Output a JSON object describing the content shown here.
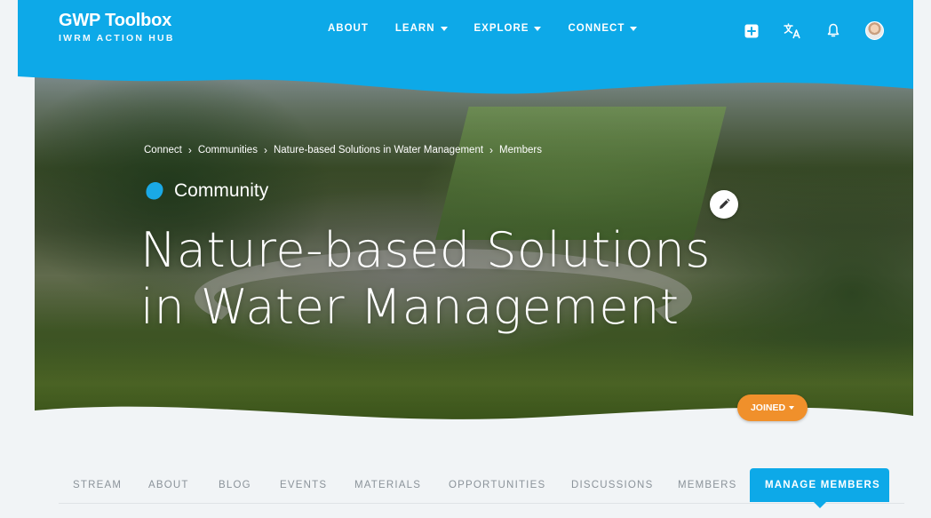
{
  "brand": {
    "title": "GWP Toolbox",
    "subtitle": "IWRM ACTION HUB"
  },
  "nav": [
    {
      "label": "ABOUT",
      "dropdown": false
    },
    {
      "label": "LEARN",
      "dropdown": true
    },
    {
      "label": "EXPLORE",
      "dropdown": true
    },
    {
      "label": "CONNECT",
      "dropdown": true
    }
  ],
  "header_icons": [
    "add-icon",
    "translate-icon",
    "bell-icon",
    "avatar"
  ],
  "breadcrumb": [
    "Connect",
    "Communities",
    "Nature-based Solutions in Water Management",
    "Members"
  ],
  "breadcrumb_separator": "›",
  "community_label": "Community",
  "page_title": "Nature-based Solutions in Water Management",
  "joined_button": "JOINED",
  "tabs": [
    {
      "label": "STREAM",
      "active": false
    },
    {
      "label": "ABOUT",
      "active": false
    },
    {
      "label": "BLOG",
      "active": false
    },
    {
      "label": "EVENTS",
      "active": false
    },
    {
      "label": "MATERIALS",
      "active": false
    },
    {
      "label": "OPPORTUNITIES",
      "active": false
    },
    {
      "label": "DISCUSSIONS",
      "active": false
    },
    {
      "label": "MEMBERS",
      "active": false
    },
    {
      "label": "MANAGE MEMBERS",
      "active": true
    }
  ],
  "colors": {
    "brand_blue": "#0da9e8",
    "accent_orange": "#f0902b",
    "page_bg": "#f1f4f6",
    "tab_text": "#8b939a"
  }
}
